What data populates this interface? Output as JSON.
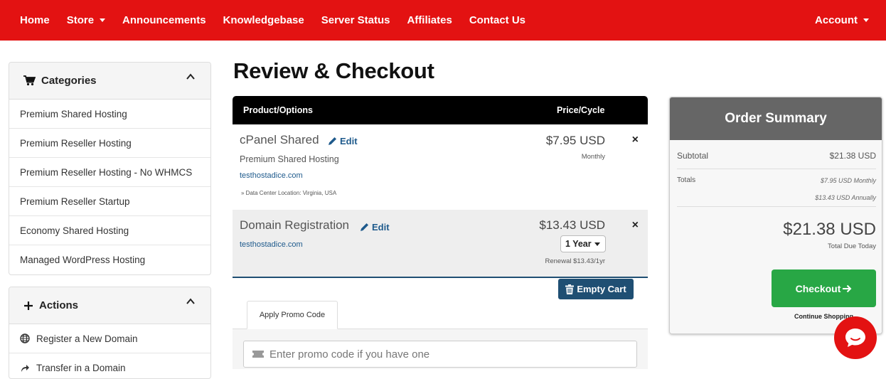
{
  "nav": {
    "items": [
      {
        "label": "Home",
        "dropdown": false
      },
      {
        "label": "Store",
        "dropdown": true
      },
      {
        "label": "Announcements",
        "dropdown": false
      },
      {
        "label": "Knowledgebase",
        "dropdown": false
      },
      {
        "label": "Server Status",
        "dropdown": false
      },
      {
        "label": "Affiliates",
        "dropdown": false
      },
      {
        "label": "Contact Us",
        "dropdown": false
      }
    ],
    "account_label": "Account",
    "brand_color": "#e31212"
  },
  "sidebar": {
    "categories": {
      "title": "Categories",
      "icon": "cart-icon",
      "items": [
        "Premium Shared Hosting",
        "Premium Reseller Hosting",
        "Premium Reseller Hosting - No WHMCS",
        "Premium Reseller Startup",
        "Economy Shared Hosting",
        "Managed WordPress Hosting"
      ]
    },
    "actions": {
      "title": "Actions",
      "icon": "plus-icon",
      "items": [
        {
          "label": "Register a New Domain",
          "icon": "globe-icon"
        },
        {
          "label": "Transfer in a Domain",
          "icon": "share-icon"
        }
      ]
    }
  },
  "page": {
    "title": "Review & Checkout"
  },
  "cart": {
    "headers": {
      "product": "Product/Options",
      "price": "Price/Cycle"
    },
    "edit_label": "Edit",
    "remove_glyph": "×",
    "items": [
      {
        "name": "cPanel Shared",
        "group": "Premium Shared Hosting",
        "domain": "testhostadice.com",
        "note": "» Data Center Location: Virginia, USA",
        "price": "$7.95 USD",
        "cycle": "Monthly"
      },
      {
        "name": "Domain Registration",
        "domain": "testhostadice.com",
        "price": "$13.43 USD",
        "period_selected": "1 Year",
        "renewal": "Renewal $13.43/1yr"
      }
    ],
    "empty_cart_label": "Empty Cart",
    "promo": {
      "tab_label": "Apply Promo Code",
      "placeholder": "Enter promo code if you have one"
    }
  },
  "summary": {
    "title": "Order Summary",
    "subtotal_label": "Subtotal",
    "subtotal_value": "$21.38 USD",
    "totals_label": "Totals",
    "totals_monthly": "$7.95 USD Monthly",
    "totals_annually": "$13.43 USD Annually",
    "total_due": "$21.38 USD",
    "total_due_label": "Total Due Today",
    "checkout_label": "Checkout",
    "continue_label": "Continue Shopping",
    "checkout_color": "#28a745"
  },
  "chat": {
    "icon": "chat-bubble-icon"
  }
}
